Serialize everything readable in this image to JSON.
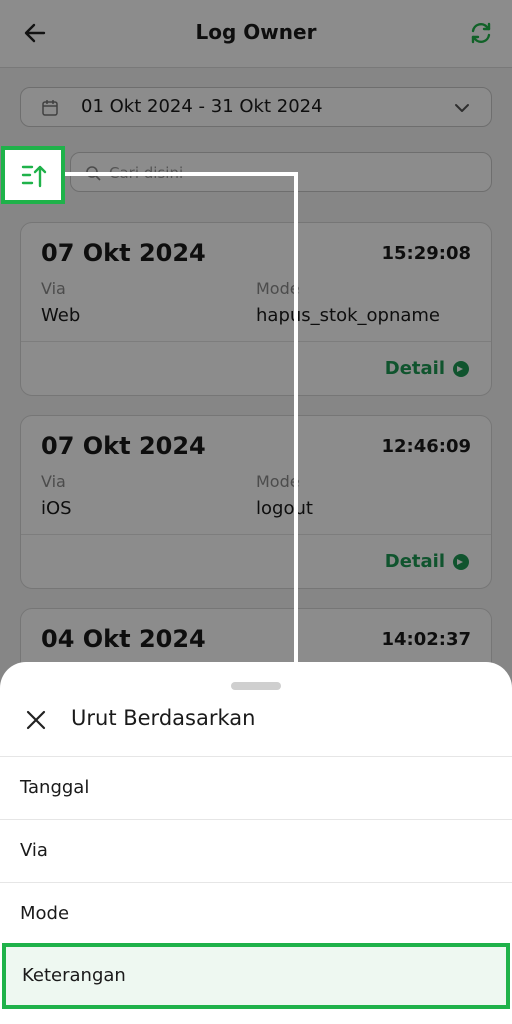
{
  "header": {
    "title": "Log Owner"
  },
  "filter": {
    "date_range": "01 Okt 2024 - 31 Okt 2024"
  },
  "search": {
    "placeholder": "Cari disini"
  },
  "labels": {
    "via": "Via",
    "mode": "Mode",
    "detail": "Detail"
  },
  "cards": [
    {
      "date": "07 Okt 2024",
      "time": "15:29:08",
      "via": "Web",
      "mode": "hapus_stok_opname"
    },
    {
      "date": "07 Okt 2024",
      "time": "12:46:09",
      "via": "iOS",
      "mode": "logout"
    },
    {
      "date": "04 Okt 2024",
      "time": "14:02:37"
    }
  ],
  "sheet": {
    "title": "Urut Berdasarkan",
    "options": [
      "Tanggal",
      "Via",
      "Mode",
      "Keterangan"
    ]
  },
  "colors": {
    "accent": "#1fb24a",
    "detail_green": "#1e9a55"
  },
  "icons": [
    "back-arrow-icon",
    "refresh-icon",
    "calendar-icon",
    "chevron-down-icon",
    "sort-icon",
    "search-icon",
    "arrow-right-circle-icon",
    "close-icon"
  ]
}
